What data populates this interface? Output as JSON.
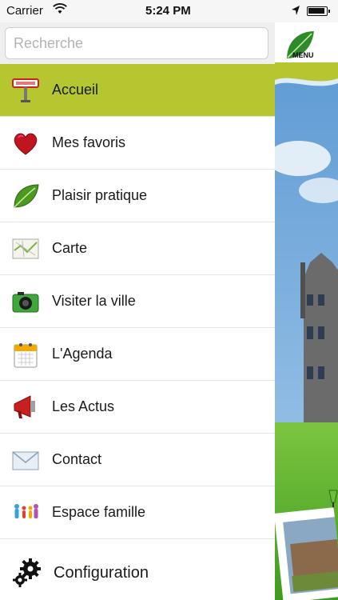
{
  "status_bar": {
    "carrier": "Carrier",
    "time": "5:24 PM"
  },
  "search": {
    "placeholder": "Recherche"
  },
  "menu": {
    "items": [
      {
        "label": "Accueil",
        "icon": "plaisir-sign-icon",
        "active": true
      },
      {
        "label": "Mes favoris",
        "icon": "heart-icon"
      },
      {
        "label": "Plaisir pratique",
        "icon": "leaf-icon"
      },
      {
        "label": "Carte",
        "icon": "map-icon"
      },
      {
        "label": "Visiter la ville",
        "icon": "camera-icon"
      },
      {
        "label": "L'Agenda",
        "icon": "calendar-icon"
      },
      {
        "label": "Les Actus",
        "icon": "megaphone-icon"
      },
      {
        "label": "Contact",
        "icon": "envelope-icon"
      },
      {
        "label": "Espace famille",
        "icon": "family-icon"
      },
      {
        "label": "Configuration",
        "icon": "gears-icon"
      }
    ]
  },
  "right_panel": {
    "menu_button_label": "MENU"
  },
  "colors": {
    "accent": "#b5c630",
    "sky": "#6fa6d8",
    "grass": "#59b52a"
  }
}
